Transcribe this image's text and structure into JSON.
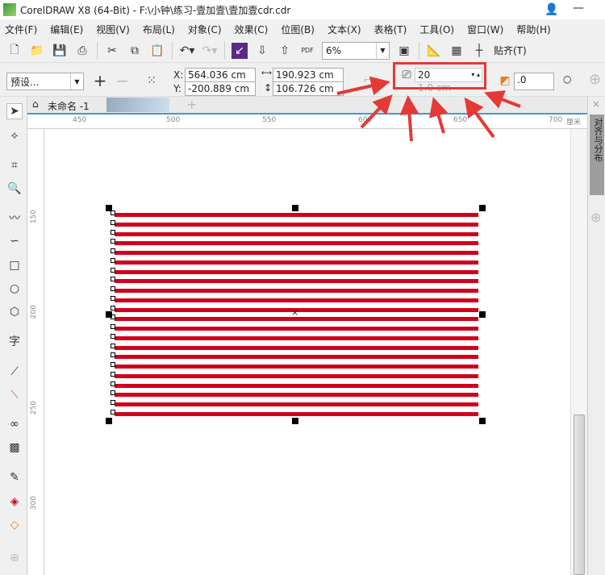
{
  "window": {
    "title": "CorelDRAW X8 (64-Bit) - F:\\小钟\\练习-壹加壹\\壹加壹cdr.cdr"
  },
  "menu": [
    "文件(F)",
    "编辑(E)",
    "视图(V)",
    "布局(L)",
    "对象(C)",
    "效果(C)",
    "位图(B)",
    "文本(X)",
    "表格(T)",
    "工具(O)",
    "窗口(W)",
    "帮助(H)"
  ],
  "toolbar": {
    "zoom": "6%",
    "snap": "贴齐(T)",
    "pdf": "PDF"
  },
  "propbar": {
    "preset": "预设...",
    "x_label": "X:",
    "x": "564.036 cm",
    "y_label": "Y:",
    "y": "-200.889 cm",
    "width": "190.923 cm",
    "height": "106.726 cm",
    "steps": "20",
    "spacing": "1.0 cm",
    "rotation": ".0"
  },
  "tabs": {
    "doc": "未命名 -1"
  },
  "ruler": {
    "h": [
      "450",
      "500",
      "550",
      "600",
      "650",
      "700"
    ],
    "unit": "厘米",
    "v": [
      "150",
      "200",
      "250",
      "300"
    ]
  },
  "docker": {
    "tab": "对齐与分布"
  },
  "colors": {
    "accent": "#e53935",
    "stripe": "#d0021b"
  }
}
